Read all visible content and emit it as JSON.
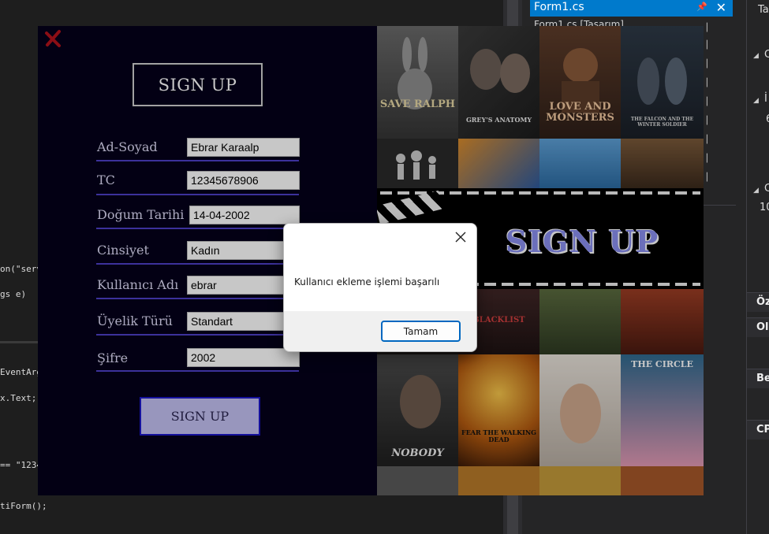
{
  "ide": {
    "code_lines": [
      "on(\"serv",
      "gs e)",
      "EventArg",
      "x.Text;",
      "== \"1234",
      "tiForm();"
    ],
    "active_tab": "Form1.cs",
    "second_tab": "Form1.cs [Tasarım]",
    "properties_partial": [
      "Ta",
      "C",
      "İ",
      "6",
      "C",
      "10",
      "Öz",
      "Ol",
      "Be",
      "CP"
    ]
  },
  "form": {
    "title_box": "SIGN UP",
    "fields": [
      {
        "label": "Ad-Soyad",
        "value": "Ebrar Karaalp"
      },
      {
        "label": "TC",
        "value": "12345678906"
      },
      {
        "label": "Doğum Tarihi",
        "value": "14-04-2002"
      },
      {
        "label": "Cinsiyet",
        "value": "Kadın"
      },
      {
        "label": "Kullanıcı Adı",
        "value": "ebrar"
      },
      {
        "label": "Üyelik Türü",
        "value": "Standart"
      },
      {
        "label": "Şifre",
        "value": "2002"
      }
    ],
    "submit_label": "SIGN UP",
    "banner_title": "SIGN UP",
    "posters": [
      "SAVE RALPH",
      "GREY'S ANATOMY",
      "LOVE AND MONSTERS",
      "THE FALCON AND THE WINTER SOLDIER",
      "BLACKLIST",
      "THE CIRCLE",
      "NOBODY",
      "FEAR THE WALKING DEAD"
    ],
    "accent_colors": {
      "background": "#05001a",
      "underline": "#4e3fc7",
      "button_fill": "#c3c0f2",
      "button_border": "#1b17c8"
    }
  },
  "dialog": {
    "message": "Kullanıcı ekleme işlemi başarılı",
    "ok_label": "Tamam"
  }
}
